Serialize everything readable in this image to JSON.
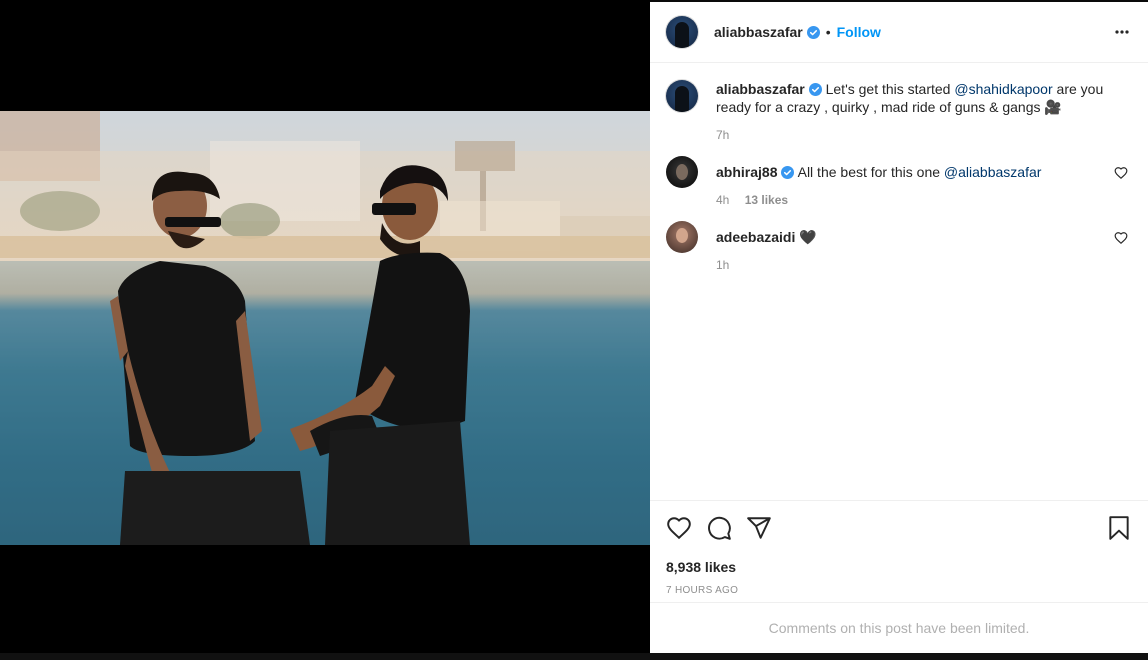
{
  "post": {
    "author": "aliabbaszafar",
    "follow_label": "Follow",
    "separator": "•",
    "caption": {
      "username": "aliabbaszafar",
      "text_before": "Let's get this started ",
      "mention": "@shahidkapoor",
      "text_after": " are you ready for a crazy , quirky , mad ride of guns & gangs ",
      "emoji": "🎥",
      "time": "7h"
    },
    "comments": [
      {
        "username": "abhiraj88",
        "verified": true,
        "text": "All the best for this one ",
        "mention": "@aliabbaszafar",
        "time": "4h",
        "likes": "13 likes"
      },
      {
        "username": "adeebazaidi",
        "verified": false,
        "text": "🖤",
        "time": "1h"
      }
    ],
    "likes": "8,938 likes",
    "timestamp": "7 HOURS AGO",
    "comments_notice": "Comments on this post have been limited."
  },
  "icons": {
    "verified": "verified-badge-icon",
    "more": "more-options-icon",
    "like": "heart-icon",
    "comment": "comment-icon",
    "share": "share-icon",
    "save": "bookmark-icon"
  },
  "colors": {
    "accent": "#0095f6",
    "verified": "#3897f0",
    "mention": "#00376b",
    "muted": "#8e8e8e"
  }
}
